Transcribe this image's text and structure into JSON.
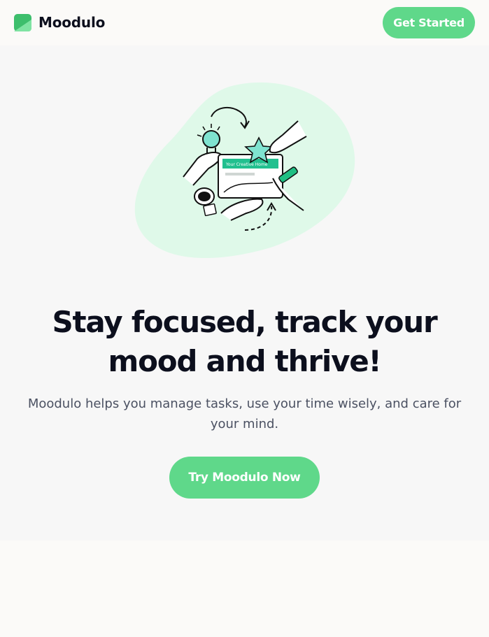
{
  "header": {
    "brand_name": "Moodulo",
    "cta_label": "Get Started"
  },
  "hero": {
    "illustration_icon": "team-collaboration-illustration",
    "illustration_screen_text": "Your Creative Home",
    "headline": "Stay focused, track your mood and thrive!",
    "subtext": "Moodulo helps you manage tasks, use your time wisely, and care for your mind.",
    "cta_label": "Try Moodulo Now"
  },
  "colors": {
    "accent": "#5fd88a",
    "hero_background": "#f7f7f7",
    "page_background": "#fbfaf8",
    "blob": "#dff9e9",
    "heading": "#0c0f1d",
    "body_text": "#4b5162"
  }
}
